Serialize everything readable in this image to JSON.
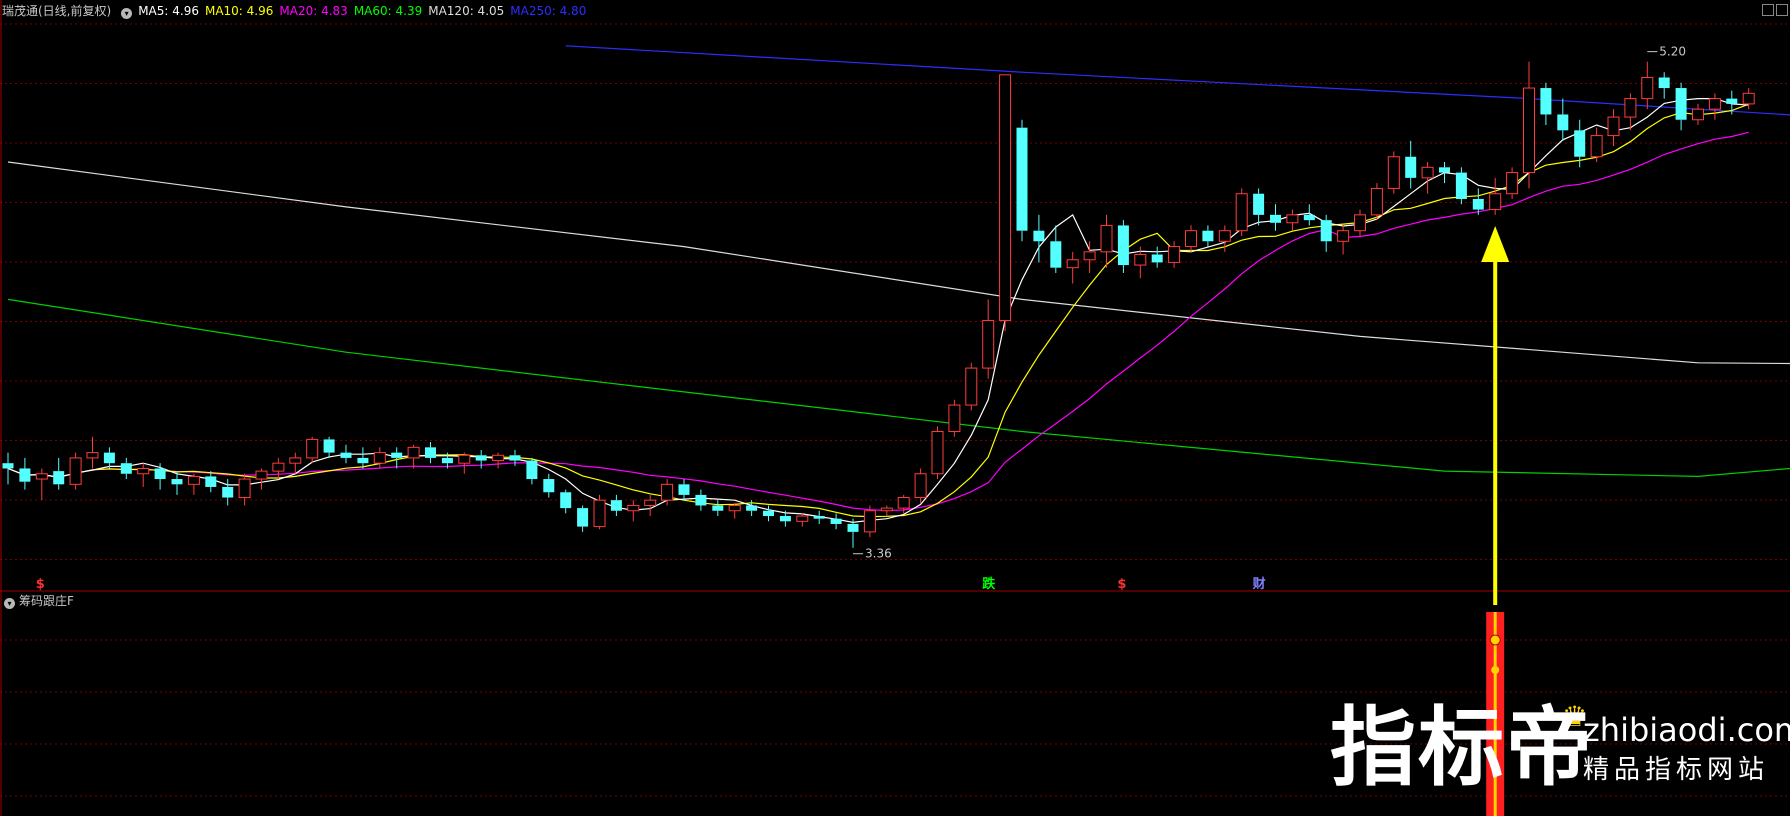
{
  "header": {
    "stock": "瑞茂通(日线,前复权)",
    "ma": [
      {
        "label": "MA5: 4.96",
        "color": "#ffffff"
      },
      {
        "label": "MA10: 4.96",
        "color": "#ffff00"
      },
      {
        "label": "MA20: 4.83",
        "color": "#ff00ff"
      },
      {
        "label": "MA60: 4.39",
        "color": "#00ff00"
      },
      {
        "label": "MA120: 4.05",
        "color": "#dcdcdc"
      },
      {
        "label": "MA250: 4.80",
        "color": "#2d2dff"
      }
    ]
  },
  "sub_panel": {
    "title": "筹码跟庄F"
  },
  "markers": [
    {
      "text": "$",
      "color": "#ff3030",
      "bar": 2
    },
    {
      "text": "跌",
      "color": "#00ff00",
      "bar": 58
    },
    {
      "text": "$",
      "color": "#ff3030",
      "bar": 66
    },
    {
      "text": "财",
      "color": "#8080ff",
      "bar": 74
    }
  ],
  "watermark": {
    "cn": "指标帝",
    "site": "zhibiaodi.com",
    "tagline": "精品指标网站"
  },
  "colors": {
    "up": "#ff3c3c",
    "down": "#54ffff",
    "grid": "#7a0000",
    "arrow": "#ffff00"
  },
  "chart_data": {
    "type": "candlestick",
    "ylim": [
      3.2,
      5.35
    ],
    "annotations": [
      {
        "text": "3.36",
        "bar": 50,
        "value": 3.36,
        "kind": "low"
      },
      {
        "text": "5.20",
        "bar": 97,
        "value": 5.2,
        "kind": "high"
      }
    ],
    "arrow_bar": 88,
    "candles": [
      [
        3.68,
        3.72,
        3.6,
        3.66
      ],
      [
        3.66,
        3.7,
        3.58,
        3.61
      ],
      [
        3.62,
        3.66,
        3.54,
        3.64
      ],
      [
        3.65,
        3.7,
        3.58,
        3.6
      ],
      [
        3.6,
        3.72,
        3.58,
        3.7
      ],
      [
        3.7,
        3.78,
        3.66,
        3.72
      ],
      [
        3.72,
        3.74,
        3.66,
        3.68
      ],
      [
        3.68,
        3.7,
        3.62,
        3.64
      ],
      [
        3.64,
        3.68,
        3.59,
        3.66
      ],
      [
        3.66,
        3.68,
        3.58,
        3.62
      ],
      [
        3.62,
        3.65,
        3.56,
        3.6
      ],
      [
        3.6,
        3.64,
        3.56,
        3.63
      ],
      [
        3.63,
        3.65,
        3.57,
        3.59
      ],
      [
        3.59,
        3.62,
        3.52,
        3.55
      ],
      [
        3.55,
        3.64,
        3.52,
        3.62
      ],
      [
        3.62,
        3.66,
        3.58,
        3.65
      ],
      [
        3.65,
        3.7,
        3.62,
        3.68
      ],
      [
        3.68,
        3.72,
        3.64,
        3.7
      ],
      [
        3.7,
        3.78,
        3.68,
        3.77
      ],
      [
        3.77,
        3.78,
        3.7,
        3.72
      ],
      [
        3.72,
        3.75,
        3.68,
        3.7
      ],
      [
        3.7,
        3.74,
        3.66,
        3.68
      ],
      [
        3.68,
        3.74,
        3.66,
        3.72
      ],
      [
        3.72,
        3.74,
        3.66,
        3.7
      ],
      [
        3.7,
        3.75,
        3.66,
        3.74
      ],
      [
        3.74,
        3.76,
        3.68,
        3.7
      ],
      [
        3.7,
        3.72,
        3.66,
        3.68
      ],
      [
        3.68,
        3.72,
        3.64,
        3.71
      ],
      [
        3.71,
        3.73,
        3.66,
        3.69
      ],
      [
        3.69,
        3.72,
        3.66,
        3.71
      ],
      [
        3.71,
        3.73,
        3.67,
        3.69
      ],
      [
        3.69,
        3.7,
        3.6,
        3.62
      ],
      [
        3.62,
        3.64,
        3.55,
        3.57
      ],
      [
        3.57,
        3.58,
        3.49,
        3.51
      ],
      [
        3.51,
        3.52,
        3.42,
        3.44
      ],
      [
        3.44,
        3.56,
        3.43,
        3.54
      ],
      [
        3.54,
        3.56,
        3.48,
        3.5
      ],
      [
        3.5,
        3.54,
        3.46,
        3.52
      ],
      [
        3.52,
        3.56,
        3.48,
        3.54
      ],
      [
        3.54,
        3.62,
        3.52,
        3.6
      ],
      [
        3.6,
        3.62,
        3.54,
        3.56
      ],
      [
        3.56,
        3.58,
        3.5,
        3.52
      ],
      [
        3.52,
        3.54,
        3.48,
        3.5
      ],
      [
        3.5,
        3.53,
        3.47,
        3.52
      ],
      [
        3.52,
        3.54,
        3.48,
        3.5
      ],
      [
        3.5,
        3.52,
        3.46,
        3.48
      ],
      [
        3.48,
        3.5,
        3.44,
        3.46
      ],
      [
        3.46,
        3.49,
        3.44,
        3.48
      ],
      [
        3.48,
        3.5,
        3.45,
        3.47
      ],
      [
        3.47,
        3.49,
        3.43,
        3.45
      ],
      [
        3.45,
        3.47,
        3.36,
        3.42
      ],
      [
        3.42,
        3.52,
        3.4,
        3.5
      ],
      [
        3.5,
        3.52,
        3.48,
        3.51
      ],
      [
        3.51,
        3.56,
        3.49,
        3.55
      ],
      [
        3.55,
        3.66,
        3.53,
        3.64
      ],
      [
        3.64,
        3.82,
        3.62,
        3.8
      ],
      [
        3.8,
        3.92,
        3.78,
        3.9
      ],
      [
        3.9,
        4.06,
        3.88,
        4.04
      ],
      [
        4.04,
        4.3,
        4.0,
        4.22
      ],
      [
        4.22,
        4.56,
        4.18,
        5.15
      ],
      [
        4.95,
        4.98,
        4.52,
        4.56
      ],
      [
        4.56,
        4.62,
        4.44,
        4.52
      ],
      [
        4.52,
        4.58,
        4.4,
        4.42
      ],
      [
        4.42,
        4.48,
        4.36,
        4.45
      ],
      [
        4.45,
        4.52,
        4.4,
        4.48
      ],
      [
        4.48,
        4.62,
        4.42,
        4.58
      ],
      [
        4.58,
        4.6,
        4.4,
        4.43
      ],
      [
        4.43,
        4.5,
        4.38,
        4.47
      ],
      [
        4.47,
        4.5,
        4.42,
        4.44
      ],
      [
        4.44,
        4.52,
        4.42,
        4.5
      ],
      [
        4.5,
        4.58,
        4.48,
        4.56
      ],
      [
        4.56,
        4.58,
        4.5,
        4.52
      ],
      [
        4.52,
        4.58,
        4.48,
        4.56
      ],
      [
        4.56,
        4.72,
        4.54,
        4.7
      ],
      [
        4.7,
        4.72,
        4.58,
        4.62
      ],
      [
        4.62,
        4.66,
        4.56,
        4.59
      ],
      [
        4.59,
        4.64,
        4.56,
        4.62
      ],
      [
        4.62,
        4.66,
        4.58,
        4.6
      ],
      [
        4.6,
        4.62,
        4.48,
        4.52
      ],
      [
        4.52,
        4.58,
        4.47,
        4.56
      ],
      [
        4.56,
        4.64,
        4.54,
        4.62
      ],
      [
        4.62,
        4.74,
        4.6,
        4.72
      ],
      [
        4.72,
        4.86,
        4.7,
        4.84
      ],
      [
        4.84,
        4.9,
        4.72,
        4.76
      ],
      [
        4.76,
        4.82,
        4.7,
        4.8
      ],
      [
        4.8,
        4.82,
        4.74,
        4.78
      ],
      [
        4.78,
        4.8,
        4.66,
        4.68
      ],
      [
        4.68,
        4.72,
        4.62,
        4.64
      ],
      [
        4.64,
        4.76,
        4.62,
        4.7
      ],
      [
        4.7,
        4.8,
        4.68,
        4.78
      ],
      [
        4.78,
        5.2,
        4.72,
        5.1
      ],
      [
        5.1,
        5.12,
        4.96,
        5.0
      ],
      [
        5.0,
        5.06,
        4.9,
        4.94
      ],
      [
        4.94,
        4.98,
        4.8,
        4.84
      ],
      [
        4.84,
        4.95,
        4.82,
        4.92
      ],
      [
        4.92,
        5.02,
        4.88,
        4.99
      ],
      [
        4.99,
        5.08,
        4.94,
        5.06
      ],
      [
        5.06,
        5.2,
        5.02,
        5.14
      ],
      [
        5.14,
        5.16,
        5.06,
        5.1
      ],
      [
        5.1,
        5.12,
        4.94,
        4.98
      ],
      [
        4.98,
        5.04,
        4.96,
        5.02
      ],
      [
        5.02,
        5.08,
        4.98,
        5.06
      ],
      [
        5.06,
        5.09,
        5.0,
        5.04
      ],
      [
        5.04,
        5.1,
        5.02,
        5.08
      ]
    ],
    "ma_lines": [
      {
        "name": "MA120",
        "color": "#dcdcdc",
        "points": [
          [
            0,
            4.82
          ],
          [
            20,
            4.65
          ],
          [
            40,
            4.5
          ],
          [
            60,
            4.3
          ],
          [
            80,
            4.16
          ],
          [
            100,
            4.06
          ],
          [
            120,
            4.05
          ],
          [
            140,
            4.04
          ],
          [
            160,
            4.02
          ],
          [
            185,
            4.05
          ]
        ]
      },
      {
        "name": "MA60",
        "color": "#00d000",
        "points": [
          [
            0,
            4.3
          ],
          [
            20,
            4.1
          ],
          [
            40,
            3.95
          ],
          [
            60,
            3.8
          ],
          [
            85,
            3.65
          ],
          [
            100,
            3.63
          ],
          [
            120,
            3.74
          ],
          [
            150,
            3.92
          ],
          [
            175,
            4.1
          ],
          [
            185,
            4.5
          ]
        ]
      },
      {
        "name": "MA250",
        "color": "#2d2dff",
        "points": [
          [
            33,
            5.26
          ],
          [
            60,
            5.16
          ],
          [
            90,
            5.06
          ],
          [
            110,
            4.98
          ],
          [
            140,
            4.88
          ],
          [
            170,
            4.8
          ],
          [
            185,
            4.76
          ]
        ]
      }
    ]
  }
}
